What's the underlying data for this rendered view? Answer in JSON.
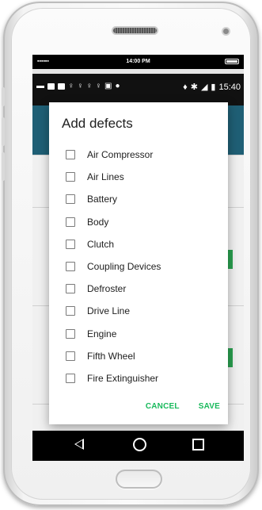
{
  "status_ios": {
    "signal_dots": "▪▪▪▪▪▪",
    "time": "14:00 PM"
  },
  "status_android": {
    "time": "15:40"
  },
  "dialog": {
    "title": "Add defects",
    "items": [
      "Air Compressor",
      "Air Lines",
      "Battery",
      "Body",
      "Clutch",
      "Coupling Devices",
      "Defroster",
      "Drive Line",
      "Engine",
      "Fifth Wheel",
      "Fire Extinguisher"
    ],
    "cancel_label": "CANCEL",
    "save_label": "SAVE"
  },
  "colors": {
    "toolbar": "#1f5f75",
    "accent": "#19b95c"
  },
  "icons": [
    "back-icon",
    "home-icon",
    "recents-icon",
    "location-icon",
    "bluetooth-icon",
    "signal-icon",
    "battery-icon"
  ]
}
